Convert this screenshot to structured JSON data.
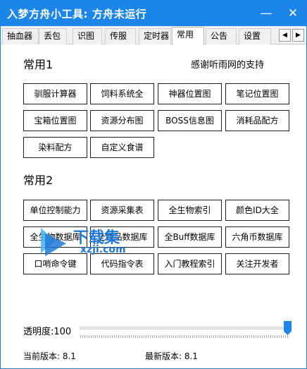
{
  "window": {
    "title": "入梦方舟小工具: 方舟未运行",
    "minimize_glyph": "—",
    "close_glyph": "✕"
  },
  "tabs": [
    {
      "label": "抽血器"
    },
    {
      "label": "丢包"
    },
    {
      "label": "识图"
    },
    {
      "label": "传服"
    },
    {
      "label": "定时器"
    },
    {
      "label": "常用",
      "active": true
    },
    {
      "label": "公告"
    },
    {
      "label": "设置"
    }
  ],
  "tab_scroll": {
    "left": "◀",
    "right": "▶"
  },
  "section1": {
    "title": "常用1",
    "thanks": "感谢听雨网的支持",
    "buttons": [
      "驯服计算器",
      "饲料系统全",
      "神器位置图",
      "笔记位置图",
      "宝箱位置图",
      "资源分布图",
      "BOSS信息图",
      "消耗品配方",
      "染料配方",
      "自定义食谱"
    ]
  },
  "section2": {
    "title": "常用2",
    "buttons": [
      "单位控制能力",
      "资源采集表",
      "全生物索引",
      "颜色ID大全",
      "全生物数据库",
      "全物品数据库",
      "全Buff数据库",
      "六角币数据库",
      "口哨命令键",
      "代码指令表",
      "入门教程索引",
      "关注开发者"
    ]
  },
  "watermark": {
    "text": "下载集",
    "sub": "xzji.com"
  },
  "opacity": {
    "label": "透明度:",
    "value": "100",
    "level_percent": 100
  },
  "versions": {
    "current": "当前版本: 8.1",
    "latest": "最新版本: 8.1"
  },
  "colors": {
    "accent": "#1b86e8",
    "watermark": "#1f79d8"
  }
}
